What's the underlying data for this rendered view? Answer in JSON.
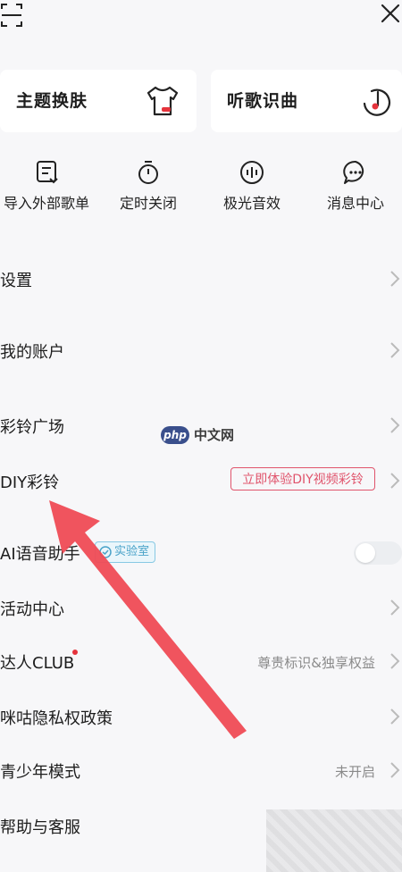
{
  "header": {
    "scan_icon": "scan-icon",
    "close_icon": "close-icon"
  },
  "cards": [
    {
      "label": "主题换肤",
      "icon": "tshirt-icon"
    },
    {
      "label": "听歌识曲",
      "icon": "music-recognize-icon"
    }
  ],
  "shortcuts": [
    {
      "label": "导入外部歌单",
      "icon": "import-playlist-icon"
    },
    {
      "label": "定时关闭",
      "icon": "timer-icon"
    },
    {
      "label": "极光音效",
      "icon": "sound-wave-icon"
    },
    {
      "label": "消息中心",
      "icon": "message-icon"
    }
  ],
  "menu": {
    "settings": "设置",
    "account": "我的账户",
    "ringtone_square": "彩铃广场",
    "diy_ringtone": "DIY彩铃",
    "diy_promo": "立即体验DIY视频彩铃",
    "ai_assistant": "AI语音助手",
    "lab_badge": "实验室",
    "ai_toggle_on": false,
    "activity_center": "活动中心",
    "club": "达人CLUB",
    "club_right": "尊贵标识&独享权益",
    "privacy": "咪咕隐私权政策",
    "teen_mode": "青少年模式",
    "teen_mode_status": "未开启",
    "help": "帮助与客服"
  },
  "watermark": {
    "logo": "php",
    "text": "中文网"
  },
  "colors": {
    "accent_red": "#e0546c",
    "arrow_red": "#ef4b55",
    "badge_blue": "#4aa3c9"
  }
}
